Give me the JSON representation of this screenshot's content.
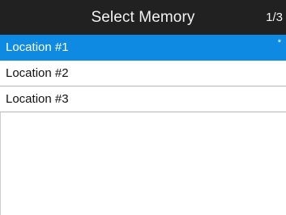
{
  "header": {
    "title": "Select Memory",
    "page_indicator": "1/3"
  },
  "list": {
    "items": [
      {
        "label": "Location #1",
        "marker": "*",
        "selected": true
      },
      {
        "label": "Location #2",
        "marker": "",
        "selected": false
      },
      {
        "label": "Location #3",
        "marker": "",
        "selected": false
      }
    ]
  },
  "colors": {
    "header_bg": "#212121",
    "selected_bg": "#0f8ae2",
    "text": "#111111",
    "divider": "#b9b9b9"
  }
}
